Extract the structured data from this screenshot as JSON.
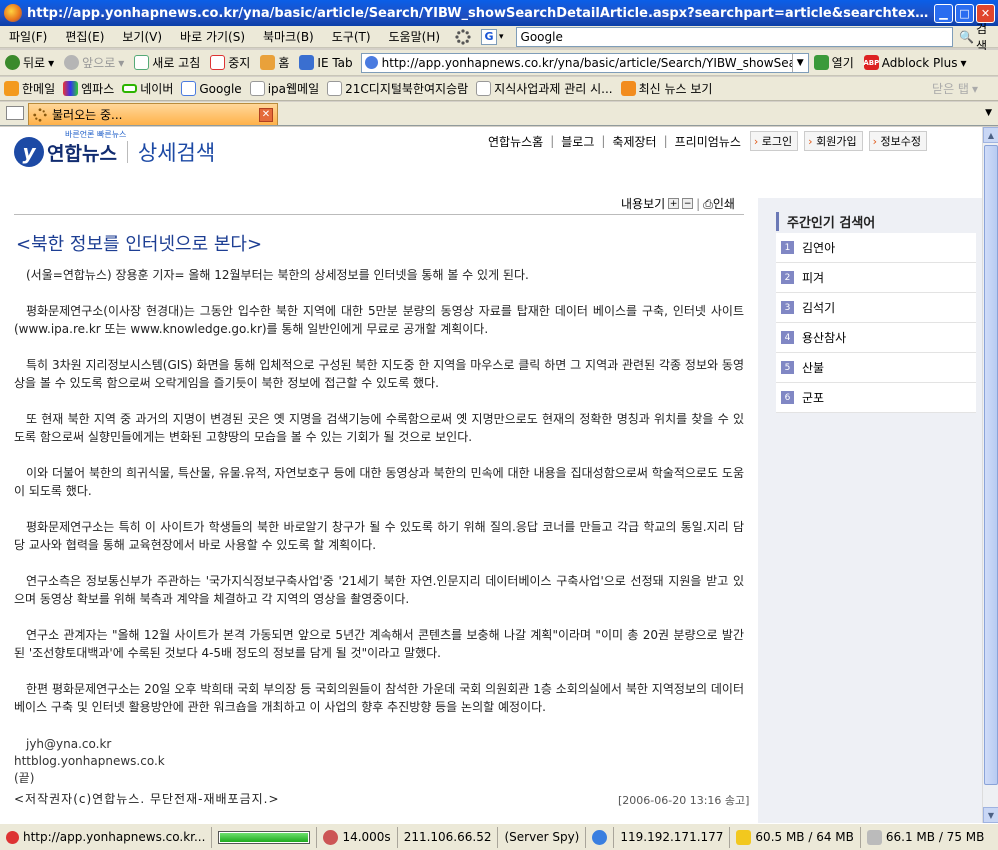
{
  "window": {
    "title": "http://app.yonhapnews.co.kr/yna/basic/article/Search/YIBW_showSearchDetailArticle.aspx?searchpart=article&searchtext=%ed%8f%89%ed%99%9..."
  },
  "menubar": {
    "items": [
      "파일(F)",
      "편집(E)",
      "보기(V)",
      "바로 가기(S)",
      "북마크(B)",
      "도구(T)",
      "도움말(H)"
    ],
    "search_value": "Google",
    "search_button": "검색"
  },
  "navbar": {
    "back": "뒤로",
    "forward": "앞으로",
    "reload": "새로 고침",
    "stop": "중지",
    "home": "홈",
    "ietab": "IE Tab",
    "url": "http://app.yonhapnews.co.kr/yna/basic/article/Search/YIBW_showSearchDe",
    "go": "열기",
    "adblock": "Adblock Plus"
  },
  "bookmarks": {
    "items": [
      "한메일",
      "엠파스",
      "네이버",
      "Google",
      "ipa웹메일",
      "21C디지털북한여지승람",
      "지식사업과제 관리 시...",
      "최신 뉴스 보기"
    ],
    "right": "닫은 탭"
  },
  "tab": {
    "label": "불러오는 중..."
  },
  "site": {
    "logo_tag": "바른언론 빠른뉴스",
    "logo_brand": "연합뉴스",
    "section": "상세검색",
    "nav_links": [
      "연합뉴스홈",
      "블로그",
      "축제장터",
      "프리미엄뉴스"
    ],
    "member_buttons": [
      "로그인",
      "회원가입",
      "정보수정"
    ],
    "tools": {
      "view": "내용보기",
      "print": "인쇄"
    }
  },
  "article": {
    "title": "<북한 정보를 인터넷으로 본다>",
    "paragraphs": [
      "(서울=연합뉴스) 장용훈 기자= 올해 12월부터는 북한의 상세정보를 인터넷을 통해 볼 수 있게 된다.",
      "평화문제연구소(이사장 현경대)는 그동안 입수한 북한 지역에 대한 5만분 분량의 동영상 자료를 탑재한 데이터 베이스를 구축, 인터넷 사이트(www.ipa.re.kr 또는 www.knowledge.go.kr)를 통해 일반인에게 무료로 공개할 계획이다.",
      "특히 3차원 지리정보시스템(GIS) 화면을 통해 입체적으로 구성된 북한 지도중 한 지역을 마우스로 클릭 하면 그 지역과 관련된 각종 정보와 동영상을 볼 수 있도록 함으로써 오락게임을 즐기듯이 북한 정보에 접근할 수 있도록 했다.",
      "또 현재 북한 지역 중 과거의 지명이 변경된 곳은 옛 지명을 검색기능에 수록함으로써 옛 지명만으로도 현재의 정확한 명칭과 위치를 찾을 수 있도록 함으로써 실향민들에게는 변화된 고향땅의 모습을 볼 수 있는 기회가 될 것으로 보인다.",
      "이와 더불어 북한의 희귀식물, 특산물, 유물.유적, 자연보호구 등에 대한 동영상과 북한의 민속에 대한 내용을 집대성함으로써 학술적으로도 도움이 되도록 했다.",
      "평화문제연구소는 특히 이 사이트가 학생들의 북한 바로알기 창구가 될 수 있도록 하기 위해 질의.응답 코너를 만들고 각급 학교의 통일.지리 담당 교사와 협력을 통해 교육현장에서 바로 사용할 수 있도록 할 계획이다.",
      "연구소측은 정보통신부가 주관하는 '국가지식정보구축사업'중 '21세기 북한 자연.인문지리 데이터베이스 구축사업'으로 선정돼 지원을 받고 있으며 동영상 확보를 위해 북측과 계약을 체결하고 각 지역의 영상을 촬영중이다.",
      "연구소 관계자는 \"올해 12월 사이트가 본격 가동되면 앞으로 5년간 계속해서 콘텐츠를 보충해 나갈 계획\"이라며 \"이미 총 20권 분량으로 발간된 '조선향토대백과'에 수록된 것보다 4-5배 정도의 정보를 담게 될 것\"이라고 말했다.",
      "한편 평화문제연구소는 20일 오후 박희태 국회 부의장 등 국회의원들이 참석한 가운데 국회 의원회관 1층 소회의실에서 북한 지역정보의 데이터베이스 구축 및 인터넷 활용방안에 관한 워크숍을 개최하고 이 사업의 향후 추진방향 등을 논의할 예정이다."
    ],
    "email": "jyh@yna.co.kr",
    "blog": "httblog.yonhapnews.co.k",
    "end": "(끝)",
    "copyright": "<저작권자(c)연합뉴스. 무단전재-재배포금지.>",
    "date": "[2006-06-20 13:16 송고]"
  },
  "sidebar": {
    "title": "주간인기 검색어",
    "items": [
      "김연아",
      "피겨",
      "김석기",
      "용산참사",
      "산불",
      "군포"
    ]
  },
  "statusbar": {
    "url": "http://app.yonhapnews.co.kr...",
    "progress_fraction": 1.0,
    "time": "14.000s",
    "ip1": "211.106.66.52",
    "spy": "(Server Spy)",
    "ip2": "119.192.171.177",
    "mem1": "60.5 MB / 64 MB",
    "mem2": "66.1 MB / 75 MB"
  }
}
